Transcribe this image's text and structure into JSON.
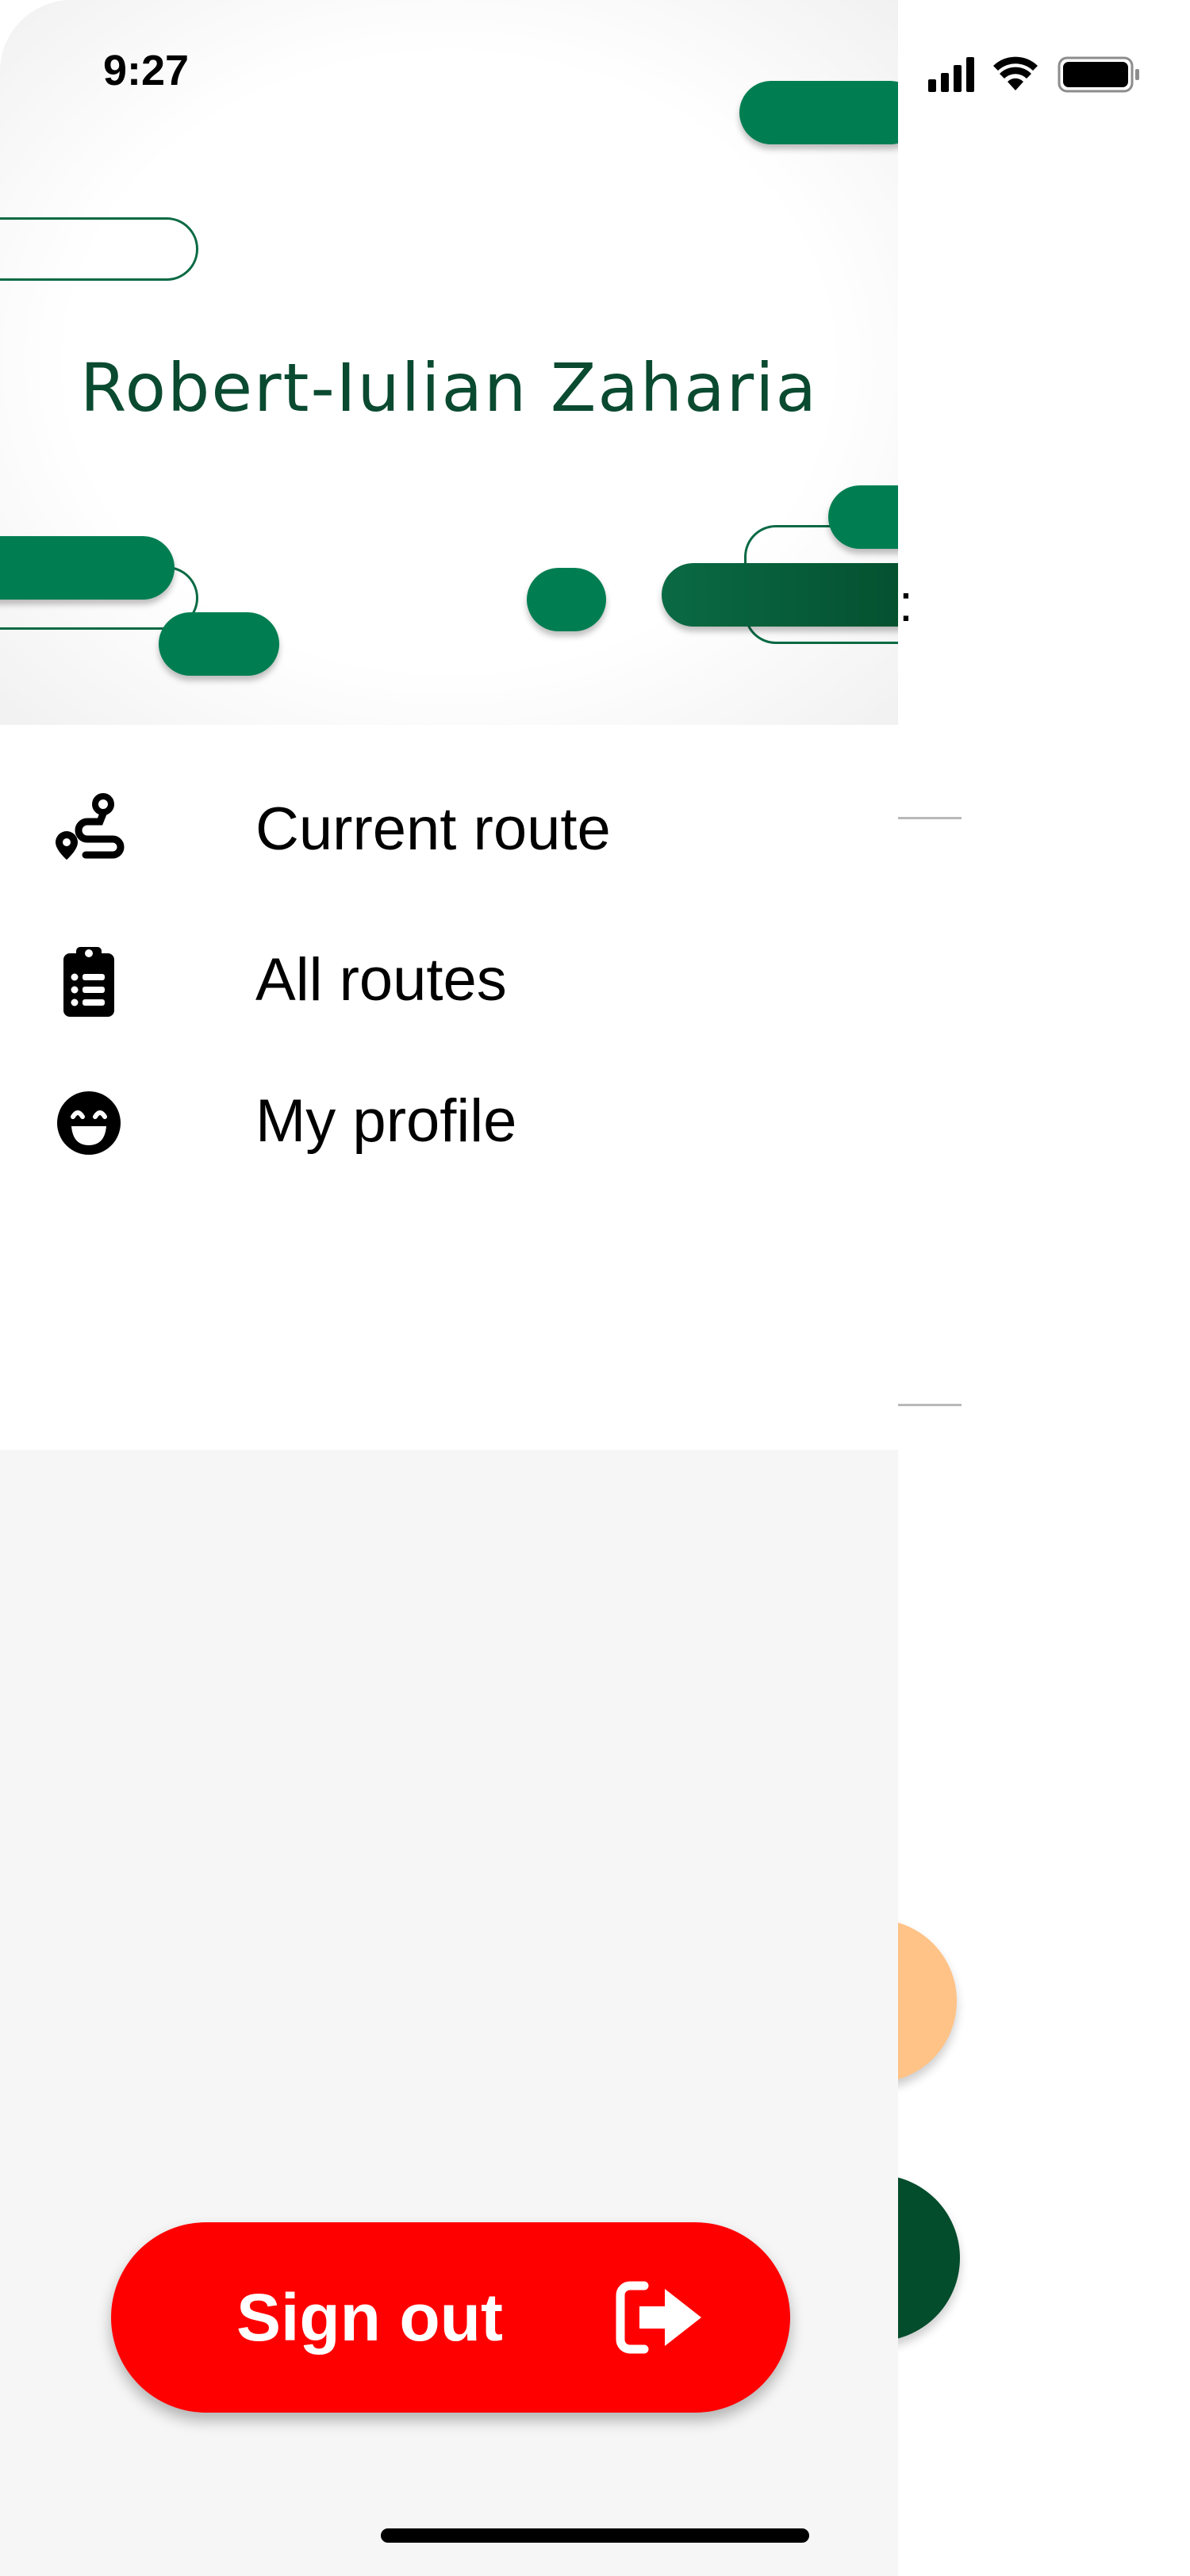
{
  "status_bar": {
    "time": "9:27"
  },
  "drawer": {
    "header": {
      "user_name": "Robert-Iulian Zaharia"
    },
    "menu": [
      {
        "label": "Current route",
        "icon": "route-icon"
      },
      {
        "label": "All routes",
        "icon": "clipboard-list-icon"
      },
      {
        "label": "My profile",
        "icon": "smiley-face-icon"
      }
    ],
    "sign_out": {
      "label": "Sign out",
      "icon": "sign-out-arrow-icon"
    }
  },
  "background_screen": {
    "label_fragment": "e:"
  },
  "colors": {
    "brand_green": "#007e52",
    "dark_green": "#0a4a30",
    "sign_out_red": "#ff0000",
    "fab_orange": "#ffc387",
    "fab_dark_green": "#034c2c",
    "drawer_bg": "#f6f6f6"
  }
}
